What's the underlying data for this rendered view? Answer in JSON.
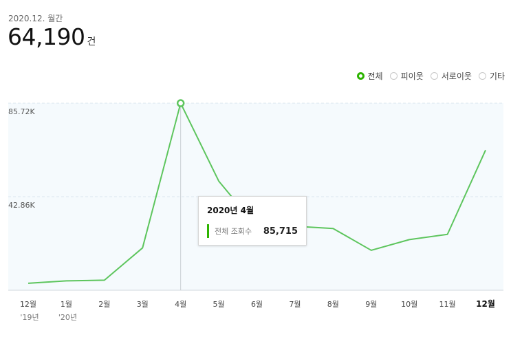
{
  "header": {
    "period": "2020.12. 월간",
    "total_value": "64,190",
    "total_unit": "건"
  },
  "legend": [
    {
      "label": "전체",
      "active": true
    },
    {
      "label": "피이웃",
      "active": false
    },
    {
      "label": "서로이웃",
      "active": false
    },
    {
      "label": "기타",
      "active": false
    }
  ],
  "tooltip": {
    "title": "2020년 4월",
    "label": "전체 조회수",
    "value": "85,715"
  },
  "colors": {
    "line": "#5dc55d",
    "accent": "#2db400",
    "plot_bg": "#f5fafd",
    "grid": "#dce7ee"
  },
  "chart_data": {
    "type": "line",
    "categories": [
      "12월",
      "1월",
      "2월",
      "3월",
      "4월",
      "5월",
      "6월",
      "7월",
      "8월",
      "9월",
      "10월",
      "11월",
      "12월"
    ],
    "sub_labels": [
      "'19년",
      "'20년",
      "",
      "",
      "",
      "",
      "",
      "",
      "",
      "",
      "",
      "",
      ""
    ],
    "series": [
      {
        "name": "전체",
        "values": [
          3200,
          4300,
          4600,
          19400,
          85715,
          50000,
          29000,
          29300,
          28300,
          18300,
          23200,
          25600,
          64190
        ]
      }
    ],
    "y_ticks": [
      {
        "value": 42860,
        "label": "42.86K"
      },
      {
        "value": 85720,
        "label": "85.72K"
      }
    ],
    "ylim": [
      0,
      85720
    ],
    "highlight_index": 4,
    "bold_index": 12,
    "grid": true
  }
}
